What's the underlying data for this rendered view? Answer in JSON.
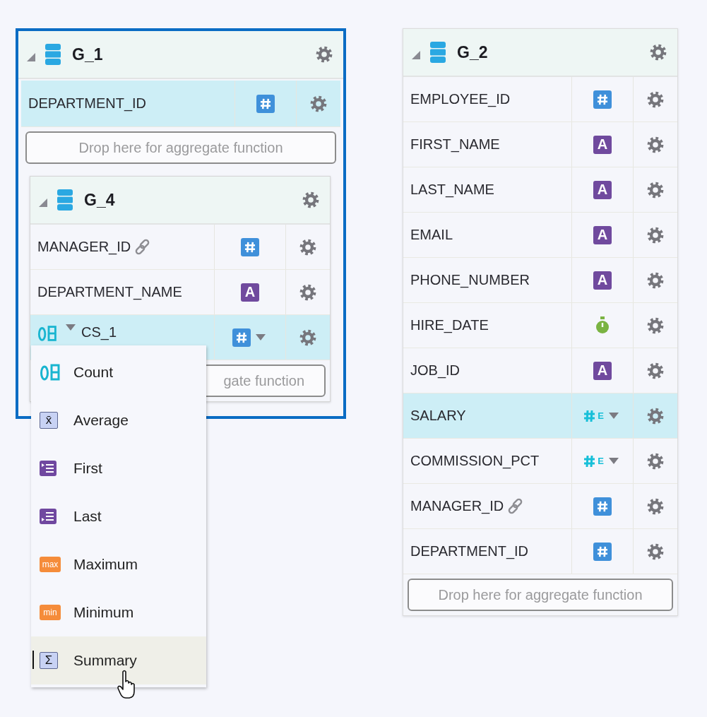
{
  "groups": [
    {
      "title": "G_1",
      "expanded": true,
      "selected": true,
      "rows": [
        {
          "name": "DEPARTMENT_ID",
          "kind": "number",
          "linked": false,
          "selected": true
        }
      ],
      "drop_zone": "Drop here for aggregate function",
      "subgroup": {
        "title": "G_4",
        "expanded": true,
        "rows": [
          {
            "name": "MANAGER_ID",
            "kind": "number",
            "linked": true,
            "selected": false
          },
          {
            "name": "DEPARTMENT_NAME",
            "kind": "text",
            "badge": "A",
            "linked": false,
            "selected": false
          },
          {
            "name": "CS_1",
            "kind": "aggregate",
            "linked": false,
            "selected": true
          }
        ],
        "drop_zone": "gate function"
      }
    },
    {
      "title": "G_2",
      "expanded": true,
      "selected": false,
      "rows": [
        {
          "name": "EMPLOYEE_ID",
          "kind": "number",
          "linked": false,
          "selected": false
        },
        {
          "name": "FIRST_NAME",
          "kind": "text",
          "badge": "A",
          "linked": false,
          "selected": false
        },
        {
          "name": "LAST_NAME",
          "kind": "text",
          "badge": "A",
          "linked": false,
          "selected": false
        },
        {
          "name": "EMAIL",
          "kind": "text",
          "badge": "A",
          "linked": false,
          "selected": false
        },
        {
          "name": "PHONE_NUMBER",
          "kind": "text",
          "badge": "A",
          "linked": false,
          "selected": false
        },
        {
          "name": "HIRE_DATE",
          "kind": "date",
          "linked": false,
          "selected": false
        },
        {
          "name": "JOB_ID",
          "kind": "text",
          "badge": "A",
          "linked": false,
          "selected": false
        },
        {
          "name": "SALARY",
          "kind": "measure",
          "badge": "E",
          "linked": false,
          "selected": true
        },
        {
          "name": "COMMISSION_PCT",
          "kind": "measure",
          "badge": "E",
          "linked": false,
          "selected": false
        },
        {
          "name": "MANAGER_ID",
          "kind": "number",
          "linked": true,
          "selected": false
        },
        {
          "name": "DEPARTMENT_ID",
          "kind": "number",
          "linked": false,
          "selected": false
        }
      ],
      "drop_zone": "Drop here for aggregate function"
    }
  ],
  "menu": {
    "items": [
      {
        "label": "Count",
        "kind": "count",
        "selected": false
      },
      {
        "label": "Average",
        "kind": "boxed",
        "badge": "x̄",
        "selected": false
      },
      {
        "label": "First",
        "kind": "first",
        "selected": false
      },
      {
        "label": "Last",
        "kind": "last",
        "selected": false
      },
      {
        "label": "Maximum",
        "kind": "tag",
        "badge": "max",
        "selected": false
      },
      {
        "label": "Minimum",
        "kind": "tag",
        "badge": "min",
        "selected": false
      },
      {
        "label": "Summary",
        "kind": "boxed",
        "badge": "Σ",
        "selected": true
      }
    ]
  }
}
